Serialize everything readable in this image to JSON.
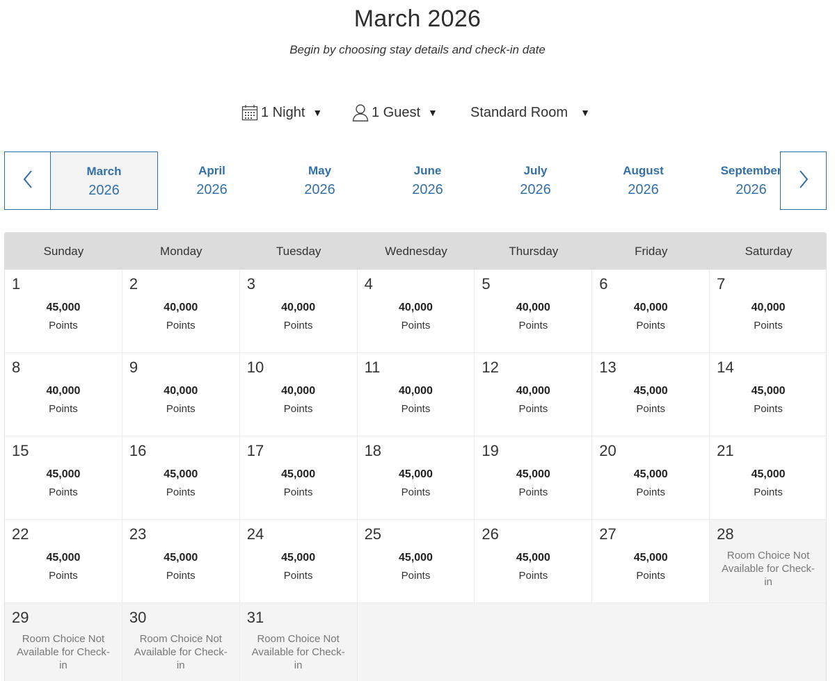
{
  "header": {
    "title": "March 2026",
    "subtitle": "Begin by choosing stay details and check-in date"
  },
  "filters": {
    "nights": {
      "label": "1 Night",
      "icon": "calendar-icon"
    },
    "guests": {
      "label": "1 Guest",
      "icon": "person-icon"
    },
    "room": {
      "label": "Standard Room"
    }
  },
  "month_nav": {
    "prev_icon": "chevron-left-icon",
    "next_icon": "chevron-right-icon",
    "selected_index": 0,
    "months": [
      {
        "name": "March",
        "year": "2026"
      },
      {
        "name": "April",
        "year": "2026"
      },
      {
        "name": "May",
        "year": "2026"
      },
      {
        "name": "June",
        "year": "2026"
      },
      {
        "name": "July",
        "year": "2026"
      },
      {
        "name": "August",
        "year": "2026"
      },
      {
        "name": "September",
        "year": "2026"
      }
    ]
  },
  "calendar": {
    "weekdays": [
      "Sunday",
      "Monday",
      "Tuesday",
      "Wednesday",
      "Thursday",
      "Friday",
      "Saturday"
    ],
    "points_label": "Points",
    "unavailable_text": "Room Choice Not Available for Check-in",
    "days": [
      {
        "day": "1",
        "points": "45,000"
      },
      {
        "day": "2",
        "points": "40,000"
      },
      {
        "day": "3",
        "points": "40,000"
      },
      {
        "day": "4",
        "points": "40,000"
      },
      {
        "day": "5",
        "points": "40,000"
      },
      {
        "day": "6",
        "points": "40,000"
      },
      {
        "day": "7",
        "points": "40,000"
      },
      {
        "day": "8",
        "points": "40,000"
      },
      {
        "day": "9",
        "points": "40,000"
      },
      {
        "day": "10",
        "points": "40,000"
      },
      {
        "day": "11",
        "points": "40,000"
      },
      {
        "day": "12",
        "points": "40,000"
      },
      {
        "day": "13",
        "points": "45,000"
      },
      {
        "day": "14",
        "points": "45,000"
      },
      {
        "day": "15",
        "points": "45,000"
      },
      {
        "day": "16",
        "points": "45,000"
      },
      {
        "day": "17",
        "points": "45,000"
      },
      {
        "day": "18",
        "points": "45,000"
      },
      {
        "day": "19",
        "points": "45,000"
      },
      {
        "day": "20",
        "points": "45,000"
      },
      {
        "day": "21",
        "points": "45,000"
      },
      {
        "day": "22",
        "points": "45,000"
      },
      {
        "day": "23",
        "points": "45,000"
      },
      {
        "day": "24",
        "points": "45,000"
      },
      {
        "day": "25",
        "points": "45,000"
      },
      {
        "day": "26",
        "points": "45,000"
      },
      {
        "day": "27",
        "points": "45,000"
      },
      {
        "day": "28",
        "unavailable": true
      },
      {
        "day": "29",
        "unavailable": true
      },
      {
        "day": "30",
        "unavailable": true
      },
      {
        "day": "31",
        "unavailable": true
      }
    ]
  },
  "colors": {
    "accent": "#3470a8",
    "header_bg": "#dcdcdc",
    "unavailable_bg": "#f4f4f4"
  }
}
